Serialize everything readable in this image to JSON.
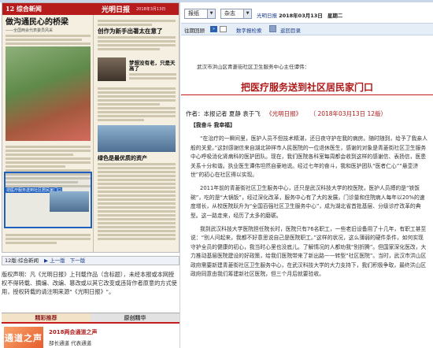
{
  "paper": {
    "page_label": "12 综合新闻",
    "masthead": "光明日报",
    "page_date": "2018年3月13日",
    "headline1": "做沟通民心的桥梁",
    "headline1_sub": "——全国两会代表委员风采",
    "headline2": "创作为新手出著太在意了",
    "headline3": "梦想没有老，只是天高了",
    "headline4": "绿色是最优质的资产",
    "headline5": "把医疗服务送到社区居民家门口",
    "highlight_tag": "把医疗服务送到社区居民家门口"
  },
  "pagenav": {
    "page": "12版:综合新闻",
    "prev": "上一版",
    "next": "下一版"
  },
  "copyright": "版权声明：凡《光明日报》上刊载作品（含标题），未经本报或本网授权不得转载、摘编、改编、篡改或以其它改变或违背作者原意的方式使用，授权转载的请注明来源\"《光明日报》\"。",
  "tabs": {
    "featured": "精彩推荐",
    "original": "原创精华"
  },
  "reco": {
    "thumb_text": "通道之声",
    "title": "2018两会通道之声",
    "subtitle": "部长通道 代表通道"
  },
  "selectors": {
    "paper": "报纸",
    "type": "杂志",
    "publication": "光明日报",
    "date_value": "2018年03月13日",
    "weekday": "星期二"
  },
  "controls": {
    "goto_label": "往期回顾",
    "goto_btn": "»",
    "digital": "数字报检索",
    "feedback": "返回目录"
  },
  "article": {
    "kicker": "武汉市洪山区青菱街社区卫生服务中心主任谭伟：",
    "title": "把医疗服务送到社区居民家门口",
    "byline": "作者：本报记者  夏静  袁于飞",
    "source": "《光明日报》",
    "date": "（ 2018年03月13日  12版）",
    "section_head": "【我奋斗 我幸福】",
    "p1": "“在治疗的一瞬间里，医护人员不但技术精湛，还日夜守护在我的病房。随时随到，给予了我亲人般的关爱。”这封感谢信来自湖北钟祥市人民医院的一位退休医生，感谢的对象是青菱街社区卫生服务中心呼吸消化肾病科的医护团队。现在，我们医院各科室每周都会收到这样的感谢信、表扬信，医患关系十分和谐。执业医生谭伟坦然自豪地说。经过七年的奋斗，我和医护团队“医者仁心”“悬壶济世”的初心在社区得以实现。",
    "p2": "2011年前的青菱街社区卫生服务中心，还只是武汉科技大学的校医院，医护人员搏的是“铁饭碗”，吃的是“大锅饭”，经过深化改革，服务中心有了大的发展，门诊量和住院病人每年以20%的速度增长，从校医院跃升为“全国百强社区卫生服务中心”，成为湖北省首批基层、分级诊疗改革的典型。这一路走来，经历了太多的磨砺。",
    "p3": "我到武汉科技大学医院担任院长时，医院只有76名职工，一些老旧设备用了十几年，有职工甚至说：“别人问起来，我都不好意思说自己是医院职工。”这样的状况，这么薄弱的硬件条件，如何实现守护全员的健康的初心，我当时心里也没底儿。了解情况的人都劝我“别折腾”。但国家深化医改，大力推动基层医院建设的好政策，给我们医院带来了新出路——转型“社区医院”。当时，武汉市洪山区政府需要新建青菱街社区卫生服务中心，在武汉科技大学的大力支持下，我们积极争取，最终洪山区政府同意由我们筹建新社区医院，但三个月后就要验收。"
  }
}
